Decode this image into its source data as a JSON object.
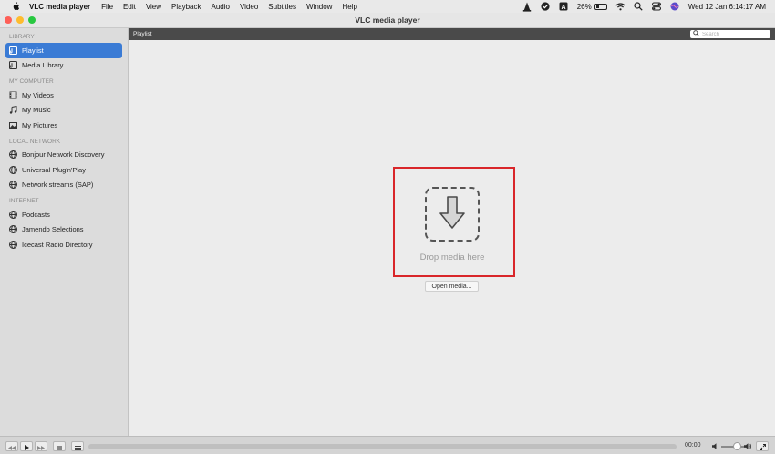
{
  "menubar": {
    "app_name": "VLC media player",
    "items": [
      "File",
      "Edit",
      "View",
      "Playback",
      "Audio",
      "Video",
      "Subtitles",
      "Window",
      "Help"
    ],
    "battery_percent": "26%",
    "datetime": "Wed 12 Jan  6:14:17 AM"
  },
  "window": {
    "title": "VLC media player"
  },
  "sidebar": {
    "sections": [
      {
        "title": "LIBRARY",
        "items": [
          {
            "label": "Playlist",
            "icon": "playlist-icon",
            "active": true
          },
          {
            "label": "Media Library",
            "icon": "media-library-icon"
          }
        ]
      },
      {
        "title": "MY COMPUTER",
        "items": [
          {
            "label": "My Videos",
            "icon": "film-icon"
          },
          {
            "label": "My Music",
            "icon": "music-note-icon"
          },
          {
            "label": "My Pictures",
            "icon": "picture-icon"
          }
        ]
      },
      {
        "title": "LOCAL NETWORK",
        "items": [
          {
            "label": "Bonjour Network Discovery",
            "icon": "globe-icon"
          },
          {
            "label": "Universal Plug'n'Play",
            "icon": "globe-icon"
          },
          {
            "label": "Network streams (SAP)",
            "icon": "globe-icon"
          }
        ]
      },
      {
        "title": "INTERNET",
        "items": [
          {
            "label": "Podcasts",
            "icon": "globe-icon"
          },
          {
            "label": "Jamendo Selections",
            "icon": "globe-icon"
          },
          {
            "label": "Icecast Radio Directory",
            "icon": "globe-icon"
          }
        ]
      }
    ]
  },
  "main": {
    "header_title": "Playlist",
    "search_placeholder": "Search",
    "drop_label": "Drop media here",
    "open_media_label": "Open media..."
  },
  "controls": {
    "time": "00:00"
  }
}
